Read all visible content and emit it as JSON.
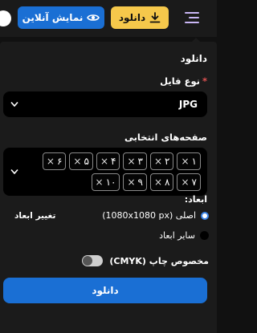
{
  "topbar": {
    "live_label": "نمایش آنلاین",
    "download_label": "دانلود",
    "icons": {
      "live": "eye-icon",
      "download": "download-icon",
      "menu": "menu-icon"
    }
  },
  "panel": {
    "title": "دانلود",
    "file_type": {
      "label": "نوع فایل",
      "required_mark": "*",
      "value": "JPG"
    },
    "pages": {
      "label": "صفحه‌های انتخابی",
      "chips": [
        "۱",
        "۲",
        "۳",
        "۴",
        "۵",
        "۶",
        "۷",
        "۸",
        "۹",
        "۱۰"
      ],
      "remove_glyph": "×"
    },
    "dimensions": {
      "label": "ابعاد:",
      "original": "اصلی (1080x1080 px)",
      "other": "سایر ابعاد",
      "resize": "تغییر ابعاد",
      "selected": "original"
    },
    "print": {
      "label": "مخصوص چاپ (CMYK)",
      "enabled": false
    },
    "submit_label": "دانلود"
  },
  "colors": {
    "accent_blue": "#1a6fd4",
    "download_yellow": "#f5c84b",
    "background": "#111111",
    "panel": "#1b1b1b"
  }
}
